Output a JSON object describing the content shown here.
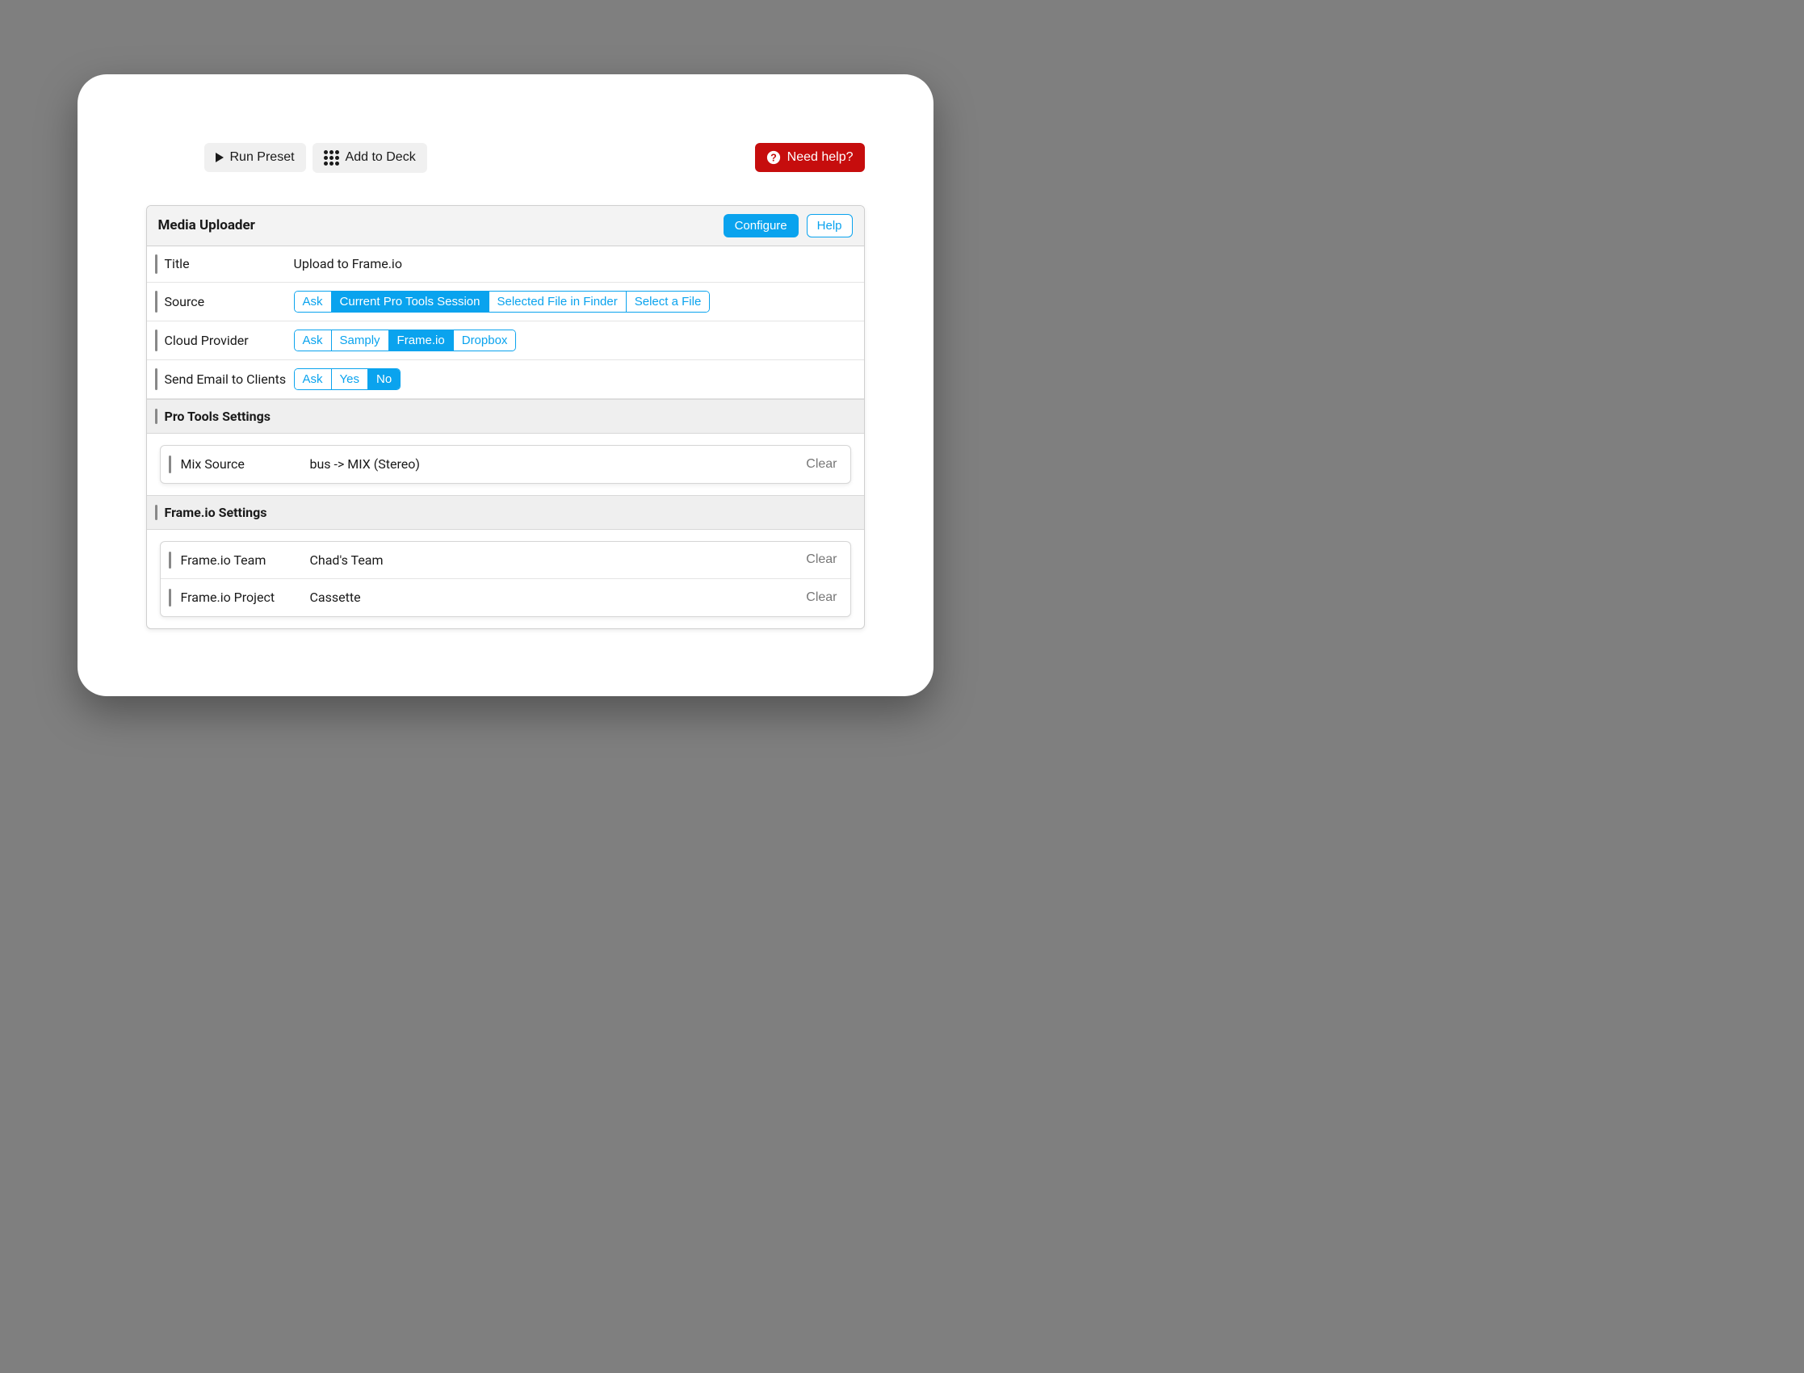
{
  "toolbar": {
    "run_preset": "Run Preset",
    "add_to_deck": "Add to Deck",
    "need_help": "Need help?"
  },
  "panel": {
    "title": "Media Uploader",
    "configure": "Configure",
    "help": "Help"
  },
  "fields": {
    "title": {
      "label": "Title",
      "value": "Upload to Frame.io"
    },
    "source": {
      "label": "Source",
      "options": [
        "Ask",
        "Current Pro Tools Session",
        "Selected File in Finder",
        "Select a File"
      ],
      "selected": "Current Pro Tools Session"
    },
    "cloud_provider": {
      "label": "Cloud Provider",
      "options": [
        "Ask",
        "Samply",
        "Frame.io",
        "Dropbox"
      ],
      "selected": "Frame.io"
    },
    "send_email": {
      "label": "Send Email to Clients",
      "options": [
        "Ask",
        "Yes",
        "No"
      ],
      "selected": "No"
    }
  },
  "sections": {
    "pro_tools": {
      "title": "Pro Tools Settings",
      "rows": [
        {
          "label": "Mix Source",
          "value": "bus -> MIX (Stereo)",
          "clear": "Clear"
        }
      ]
    },
    "frameio": {
      "title": "Frame.io Settings",
      "rows": [
        {
          "label": "Frame.io Team",
          "value": "Chad's Team",
          "clear": "Clear"
        },
        {
          "label": "Frame.io Project",
          "value": "Cassette",
          "clear": "Clear"
        }
      ]
    }
  }
}
